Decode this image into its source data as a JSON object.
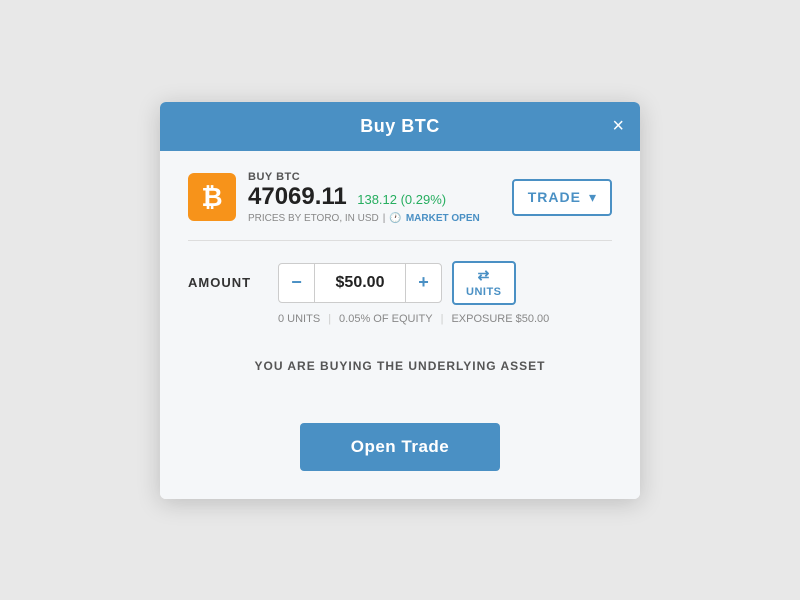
{
  "modal": {
    "title": "Buy BTC",
    "close_label": "×"
  },
  "asset": {
    "icon": "₿",
    "buy_label": "BUY BTC",
    "price": "47069.11",
    "change": "138.12 (0.29%)",
    "meta": "PRICES BY ETORO, IN USD",
    "market_status": "MARKET OPEN"
  },
  "trade_dropdown": {
    "label": "TRADE",
    "arrow": "▾"
  },
  "amount_section": {
    "label": "AMOUNT",
    "minus_label": "−",
    "plus_label": "+",
    "value": "$50.00",
    "units_arrows": "⇄",
    "units_label": "UNITS"
  },
  "info": {
    "units": "0 UNITS",
    "equity": "0.05% OF EQUITY",
    "exposure": "EXPOSURE $50.00"
  },
  "message": "YOU ARE BUYING THE UNDERLYING ASSET",
  "open_trade_btn": "Open Trade"
}
